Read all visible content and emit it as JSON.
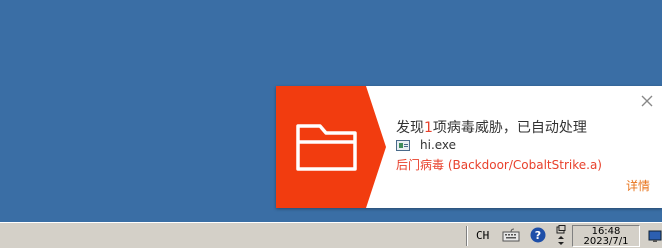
{
  "notification": {
    "title_before": "发现",
    "threat_count": "1",
    "title_after": "项病毒威胁，已自动处理",
    "file_name": "hi.exe",
    "threat_label": "后门病毒 (Backdoor/CobaltStrike.a)",
    "details_label": "详情",
    "colors": {
      "accent": "#f23c0f",
      "threat_text": "#e8412c",
      "details_text": "#e8741c"
    }
  },
  "taskbar": {
    "language": "CH",
    "clock_time": "16:48",
    "clock_date": "2023/7/1"
  },
  "icons": [
    "folder-icon",
    "close-icon",
    "file-icon",
    "keyboard-icon",
    "help-icon",
    "expand-arrows-icon",
    "network-icon"
  ]
}
